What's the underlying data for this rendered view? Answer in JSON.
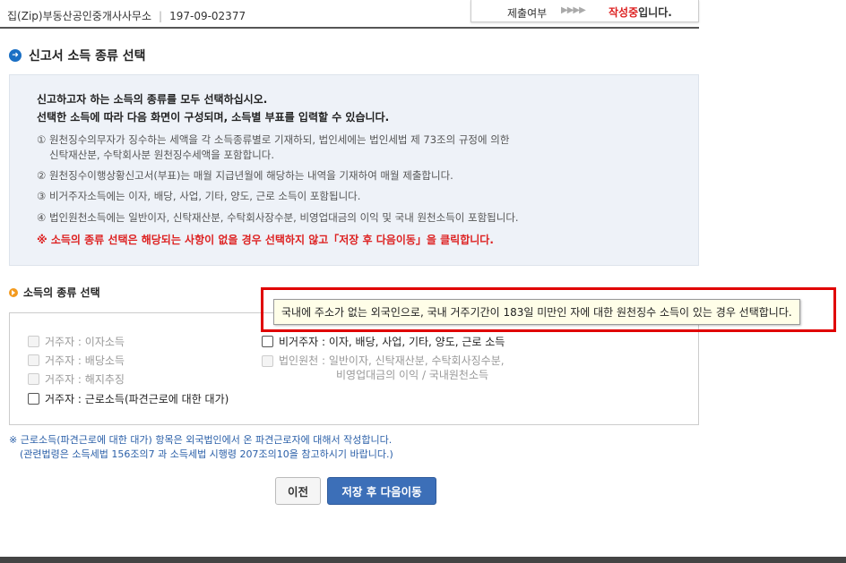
{
  "header": {
    "company": "집(Zip)부동산공인중개사사무소",
    "business_no": "197-09-02377",
    "status_label": "제출여부",
    "status_arrows": "▶▶▶▶",
    "status_value": "작성중",
    "status_suffix": "입니다."
  },
  "section": {
    "title": "신고서 소득 종류 선택"
  },
  "info": {
    "lead1": "신고하고자 하는 소득의 종류를 모두 선택하십시오.",
    "lead2": "선택한 소득에 따라 다음 화면이 구성되며, 소득별 부표를 입력할 수 있습니다.",
    "item1a": "① 원천징수의무자가 징수하는 세액을 각 소득종류별로 기재하되, 법인세에는 법인세법 제 73조의 규정에 의한",
    "item1b": "신탁재산분, 수탁회사분 원천징수세액을 포함합니다.",
    "item2": "② 원천징수이행상황신고서(부표)는 매월 지급년월에 해당하는 내역을 기재하여 매월 제출합니다.",
    "item3": "③ 비거주자소득에는 이자, 배당, 사업, 기타, 양도, 근로 소득이 포함됩니다.",
    "item4": "④ 법인원천소득에는 일반이자, 신탁재산분, 수탁회사장수분, 비영업대금의 이익 및 국내 원천소득이 포함됩니다.",
    "warning": "※ 소득의 종류 선택은 해당되는 사항이 없을 경우 선택하지 않고「저장 후 다음이동」을 클릭합니다."
  },
  "selection": {
    "title": "소득의 종류 선택",
    "options": [
      {
        "label": "거주자 : 이자소득"
      },
      {
        "label": "거주자 : 배당소득"
      },
      {
        "label": "거주자 : 해지추징"
      },
      {
        "label": "거주자 : 근로소득(파견근로에 대한 대가)"
      },
      {
        "label": "비거주자 : 이자, 배당, 사업, 기타, 양도, 근로 소득"
      },
      {
        "label": "법인원천 : 일반이자, 신탁재산분, 수탁회사징수분,",
        "label2": "비영업대금의 이익 / 국내원천소득"
      }
    ]
  },
  "note": {
    "line1": "※ 근로소득(파견근로에 대한 대가) 항목은 외국법인에서 온 파견근로자에 대해서 작성합니다.",
    "line2": "(관련법령은 소득세법 156조의7 과 소득세법 시행령 207조의10을 참고하시기 바랍니다.)"
  },
  "buttons": {
    "prev": "이전",
    "next": "저장 후 다음이동"
  },
  "tooltip": {
    "text": "국내에 주소가 없는 외국인으로, 국내 거주기간이 183일 미만인 자에 대한 원천징수 소득이 있는 경우 선택합니다."
  }
}
